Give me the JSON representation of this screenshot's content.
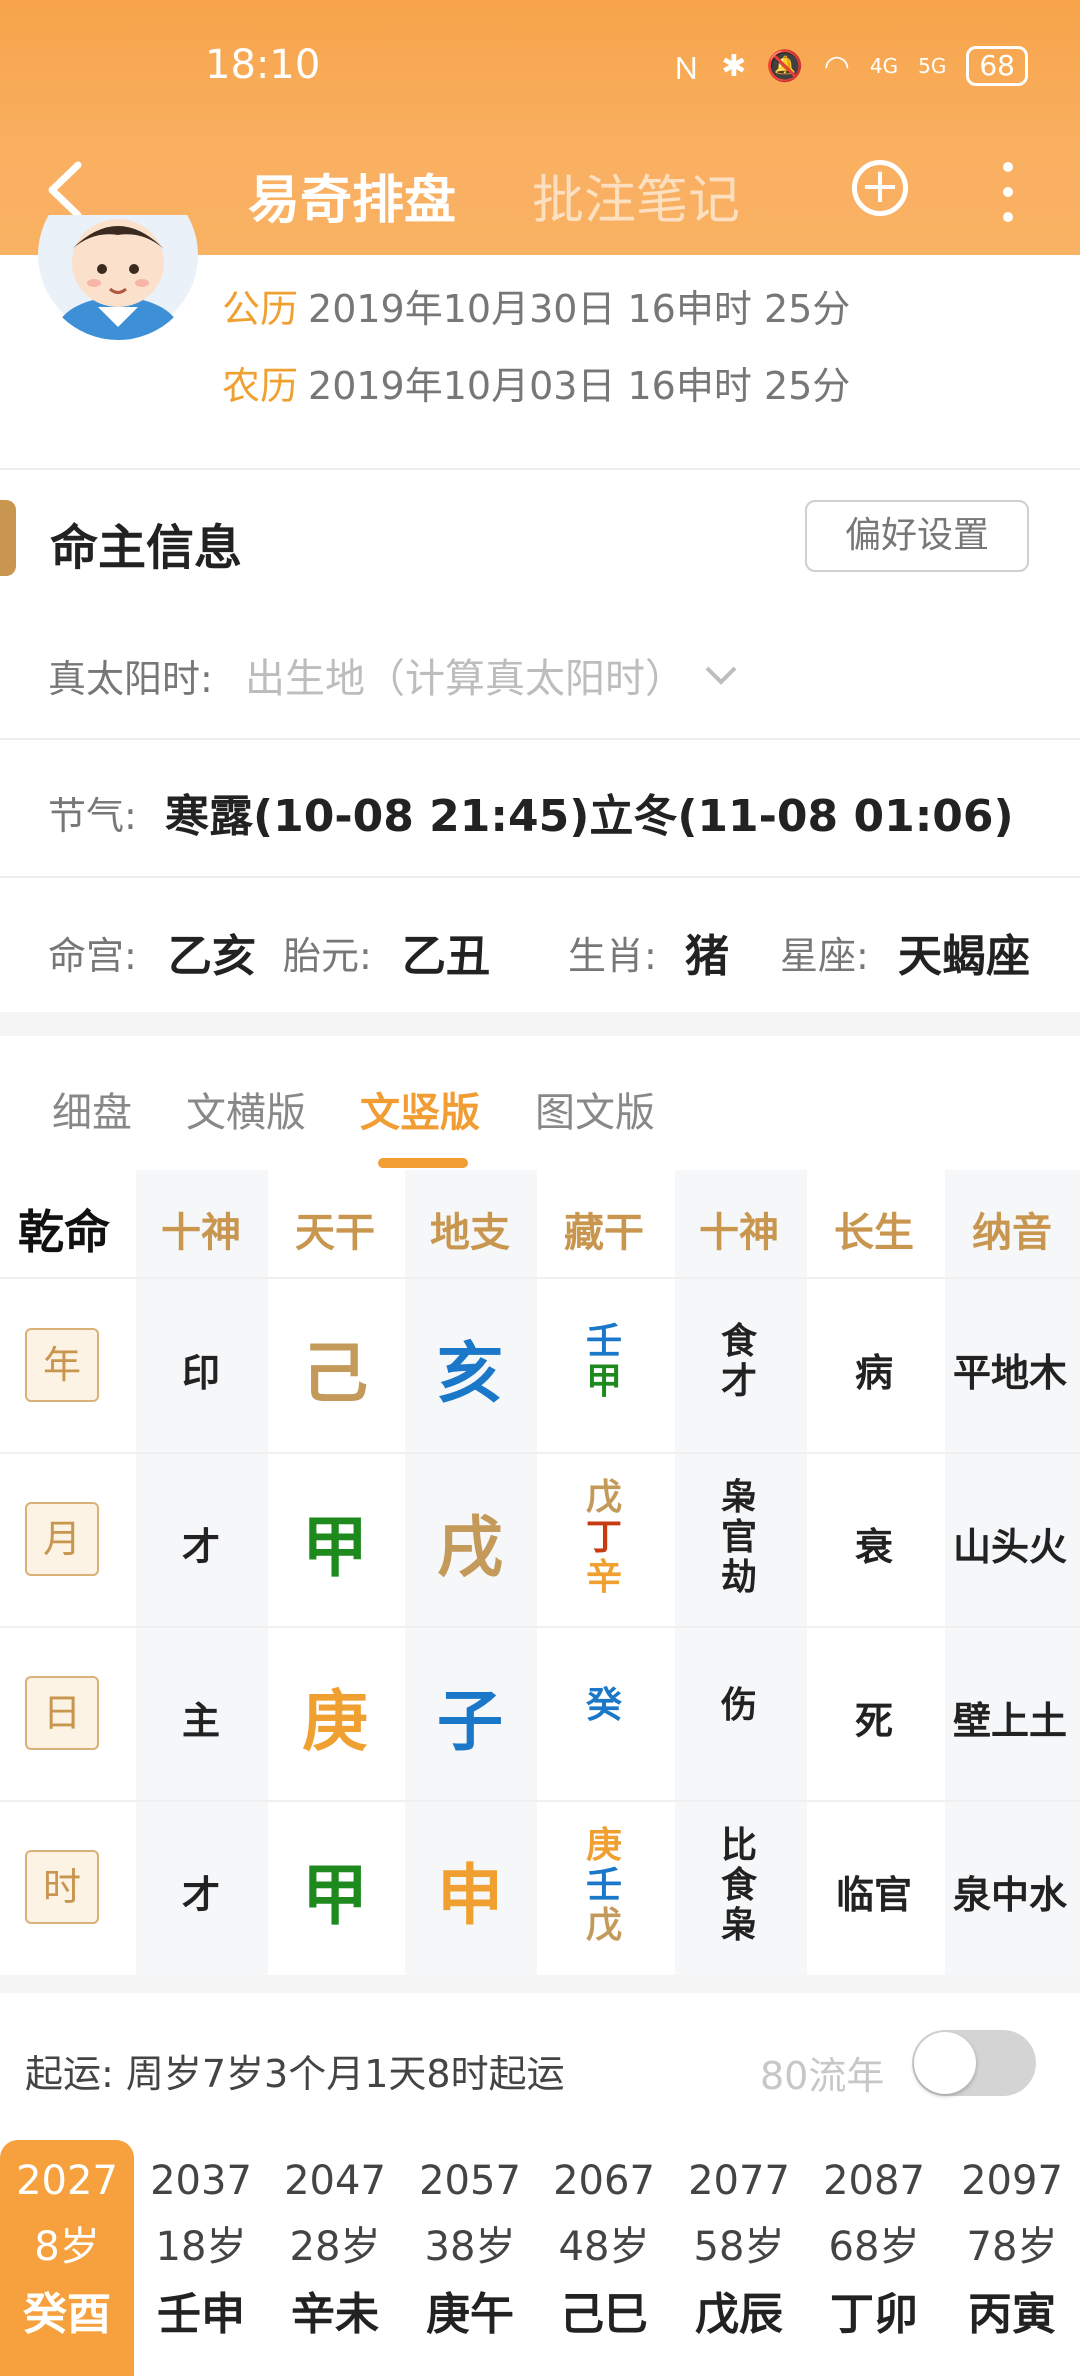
{
  "status": {
    "time": "18:10",
    "battery": "68",
    "signal1": "4G",
    "signal2": "5G"
  },
  "nav": {
    "title": "易奇排盘",
    "tab2": "批注笔记"
  },
  "profile": {
    "solar_label": "公历",
    "solar": "2019年10月30日 16申时 25分",
    "lunar_label": "农历",
    "lunar": "2019年10月03日 16申时 25分"
  },
  "section": {
    "title": "命主信息",
    "pref_button": "偏好设置"
  },
  "info": {
    "true_solar_label": "真太阳时:",
    "true_solar_value": "出生地（计算真太阳时）",
    "jieqi_label": "节气:",
    "jieqi_value": "寒露(10-08 21:45)立冬(11-08 01:06)",
    "minggong_label": "命宫:",
    "minggong": "乙亥",
    "taiyuan_label": "胎元:",
    "taiyuan": "乙丑",
    "shengxiao_label": "生肖:",
    "shengxiao": "猪",
    "xingzuo_label": "星座:",
    "xingzuo": "天蝎座"
  },
  "tabs": [
    "细盘",
    "文横版",
    "文竖版",
    "图文版"
  ],
  "active_tab": "文竖版",
  "grid": {
    "gender": "乾命",
    "headers": [
      "十神",
      "天干",
      "地支",
      "藏干",
      "十神",
      "长生",
      "纳音"
    ],
    "rows": [
      {
        "pillar": "年",
        "shishen": "印",
        "gan": "己",
        "zhi": "亥",
        "canggan": [
          "壬",
          "甲"
        ],
        "shishen2": [
          "食",
          "才"
        ],
        "changsheng": "病",
        "nayin": "平地木"
      },
      {
        "pillar": "月",
        "shishen": "才",
        "gan": "甲",
        "zhi": "戌",
        "canggan": [
          "戊",
          "丁",
          "辛"
        ],
        "shishen2": [
          "枭",
          "官",
          "劫"
        ],
        "changsheng": "衰",
        "nayin": "山头火"
      },
      {
        "pillar": "日",
        "shishen": "主",
        "gan": "庚",
        "zhi": "子",
        "canggan": [
          "癸"
        ],
        "shishen2": [
          "伤"
        ],
        "changsheng": "死",
        "nayin": "壁上土"
      },
      {
        "pillar": "时",
        "shishen": "才",
        "gan": "甲",
        "zhi": "申",
        "canggan": [
          "庚",
          "壬",
          "戊"
        ],
        "shishen2": [
          "比",
          "食",
          "枭"
        ],
        "changsheng": "临官",
        "nayin": "泉中水"
      }
    ]
  },
  "qiyun": {
    "text": "起运:  周岁7岁3个月1天8时起运",
    "liunian_label": "80流年",
    "liunian_on": false
  },
  "dayun": [
    {
      "year": "2027",
      "age": "8岁",
      "gz": "癸酉"
    },
    {
      "year": "2037",
      "age": "18岁",
      "gz": "壬申"
    },
    {
      "year": "2047",
      "age": "28岁",
      "gz": "辛未"
    },
    {
      "year": "2057",
      "age": "38岁",
      "gz": "庚午"
    },
    {
      "year": "2067",
      "age": "48岁",
      "gz": "己巳"
    },
    {
      "year": "2077",
      "age": "58岁",
      "gz": "戊辰"
    },
    {
      "year": "2087",
      "age": "68岁",
      "gz": "丁卯"
    },
    {
      "year": "2097",
      "age": "78岁",
      "gz": "丙寅"
    }
  ],
  "colors": {
    "accent": "#f19d33",
    "brown": "#c8964e",
    "wood": "#1e8a1e",
    "water": "#1b78c8",
    "earth": "#c39a5a",
    "metal": "#f0a030",
    "fire": "#c83a12"
  }
}
